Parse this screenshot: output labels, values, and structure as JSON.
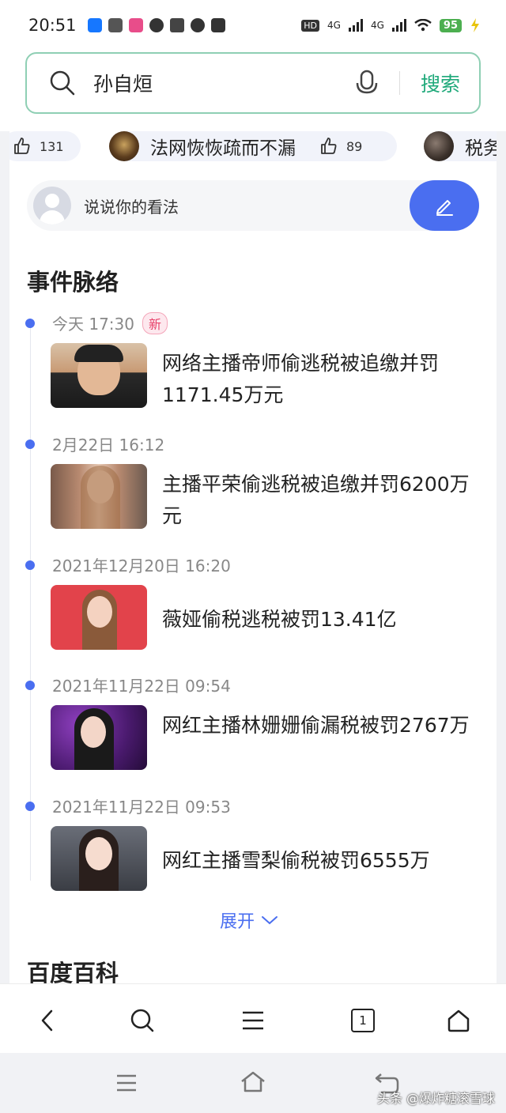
{
  "status_bar": {
    "time": "20:51",
    "network_1": "4G",
    "network_2": "4G",
    "battery": "95",
    "app_icons": [
      "alipay-icon",
      "toutiao-icon",
      "weibo-icon",
      "chat-bubble-icon",
      "translate-icon",
      "compass-icon",
      "star-icon"
    ]
  },
  "search": {
    "query": "孙自烜",
    "button_label": "搜索",
    "accent_color": "#1fa97a"
  },
  "chips": [
    {
      "likes": "131"
    },
    {
      "title": "法网恢恢疏而不漏",
      "likes": "89"
    },
    {
      "title": "税务"
    }
  ],
  "comment": {
    "placeholder": "说说你的看法"
  },
  "timeline": {
    "title": "事件脉络",
    "events": [
      {
        "date": "今天 17:30",
        "badge": "新",
        "title": "网络主播帝师偷逃税被追缴并罚1171.45万元"
      },
      {
        "date": "2月22日 16:12",
        "title": "主播平荣偷逃税被追缴并罚6200万元"
      },
      {
        "date": "2021年12月20日 16:20",
        "title": "薇娅偷税逃税被罚13.41亿"
      },
      {
        "date": "2021年11月22日 09:54",
        "title": "网红主播林姗姗偷漏税被罚2767万"
      },
      {
        "date": "2021年11月22日 09:53",
        "title": "网红主播雪梨偷税被罚6555万"
      }
    ],
    "expand_label": "展开"
  },
  "next_section": {
    "title": "百度百科"
  },
  "browser_bar": {
    "tab_count": "1"
  },
  "watermark": "头条 @爆炸糖滚雪球",
  "colors": {
    "accent_blue": "#4a6ef0",
    "badge_pink": "#e8436b"
  }
}
